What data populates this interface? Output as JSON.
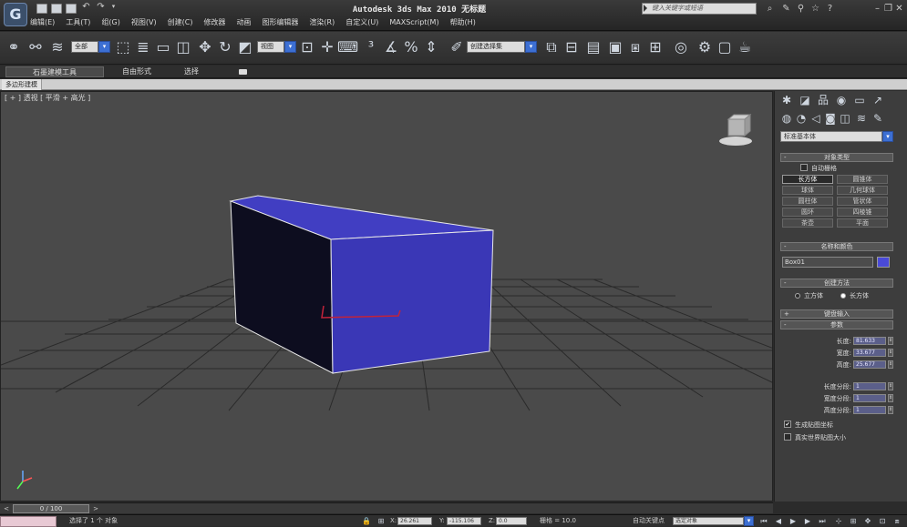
{
  "title_bar": {
    "app_title": "Autodesk 3ds Max  2010   无标题",
    "search_placeholder": "键入关键字或短语",
    "logo_letter": "G"
  },
  "menu": [
    "编辑(E)",
    "工具(T)",
    "组(G)",
    "视图(V)",
    "创建(C)",
    "修改器",
    "动画",
    "图形编辑器",
    "渲染(R)",
    "自定义(U)",
    "MAXScript(M)",
    "帮助(H)"
  ],
  "toolbar": {
    "selection_filter": "全部",
    "reference_coord": "视图",
    "named_selection": "创建选择集"
  },
  "ribbon": {
    "tabs": [
      "石墨建模工具",
      "自由形式",
      "选择"
    ],
    "sub_label": "多边形建模"
  },
  "viewport": {
    "label": "[ + ] 透视 [ 平滑 + 高光 ]",
    "object_color": "#3a37b6"
  },
  "command_panel": {
    "category": "标准基本体",
    "object_type_title": "对象类型",
    "autogrid_label": "自动栅格",
    "primitives": [
      "长方体",
      "圆锥体",
      "球体",
      "几何球体",
      "圆柱体",
      "管状体",
      "圆环",
      "四棱锥",
      "茶壶",
      "平面"
    ],
    "active_primitive": "长方体",
    "name_color_title": "名称和颜色",
    "object_name": "Box01",
    "swatch_color": "#4a4ad8",
    "creation_method_title": "创建方法",
    "creation_options": [
      "立方体",
      "长方体"
    ],
    "keyboard_entry_title": "键盘输入",
    "parameters_title": "参数",
    "length_label": "长度:",
    "length_value": "81.633",
    "width_label": "宽度:",
    "width_value": "33.677",
    "height_label": "高度:",
    "height_value": "25.677",
    "length_segs_label": "长度分段:",
    "length_segs": "1",
    "width_segs_label": "宽度分段:",
    "width_segs": "1",
    "height_segs_label": "高度分段:",
    "height_segs": "1",
    "gen_mapping_label": "生成贴图坐标",
    "real_world_label": "真实世界贴图大小"
  },
  "timeline": {
    "frame_label": "0 / 100"
  },
  "status_bar": {
    "selection_msg": "选择了 1 个 对象",
    "x_value": "26.261",
    "y_value": "-115.106",
    "z_value": "0.0",
    "grid_label": "栅格 = 10.0",
    "auto_key_label": "自动关键点",
    "selected_set": "选定对象"
  }
}
